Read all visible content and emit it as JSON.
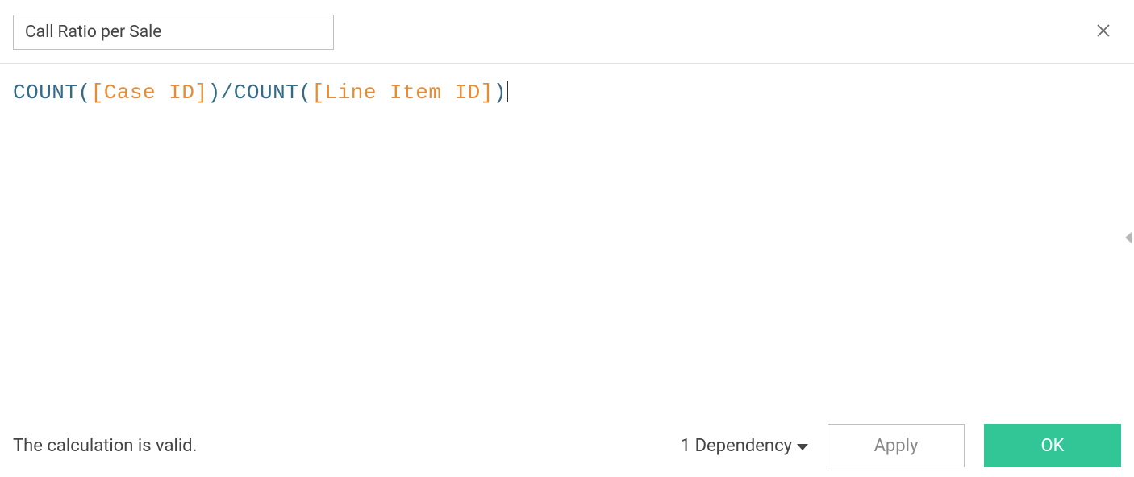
{
  "header": {
    "formula_name": "Call Ratio per Sale"
  },
  "formula": {
    "tokens": {
      "count1": "COUNT",
      "lp1": "(",
      "field1": "[Case ID]",
      "rp1": ")",
      "op": "/",
      "count2": "COUNT",
      "lp2": "(",
      "field2": "[Line Item ID]",
      "rp2": ")"
    }
  },
  "footer": {
    "status": "The calculation is valid.",
    "dependency_label": "1 Dependency",
    "apply_label": "Apply",
    "ok_label": "OK"
  }
}
